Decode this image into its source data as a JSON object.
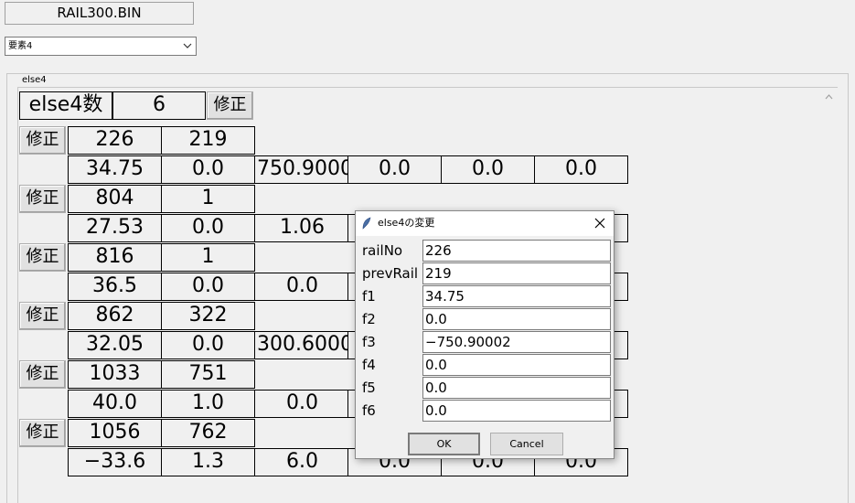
{
  "file_label": "RAIL300.BIN",
  "element_select": {
    "value": "要素4"
  },
  "group": {
    "label": "else4",
    "count_label": "else4数",
    "count_value": "6",
    "modify_label": "修正"
  },
  "records": [
    {
      "modify": "修正",
      "railNo": "226",
      "prevRail": "219",
      "vals": [
        "34.75",
        "0.0",
        "750.9000",
        "0.0",
        "0.0",
        "0.0"
      ]
    },
    {
      "modify": "修正",
      "railNo": "804",
      "prevRail": "1",
      "vals": [
        "27.53",
        "0.0",
        "1.06",
        "",
        "",
        ""
      ]
    },
    {
      "modify": "修正",
      "railNo": "816",
      "prevRail": "1",
      "vals": [
        "36.5",
        "0.0",
        "0.0",
        "",
        "",
        ""
      ]
    },
    {
      "modify": "修正",
      "railNo": "862",
      "prevRail": "322",
      "vals": [
        "32.05",
        "0.0",
        "300.6000",
        "",
        "",
        ""
      ]
    },
    {
      "modify": "修正",
      "railNo": "1033",
      "prevRail": "751",
      "vals": [
        "40.0",
        "1.0",
        "0.0",
        "",
        "",
        ""
      ]
    },
    {
      "modify": "修正",
      "railNo": "1056",
      "prevRail": "762",
      "vals": [
        "−33.6",
        "1.3",
        "6.0",
        "0.0",
        "0.0",
        "0.0"
      ]
    }
  ],
  "dialog": {
    "title": "else4の変更",
    "fields": [
      {
        "label": "railNo",
        "value": "226"
      },
      {
        "label": "prevRail",
        "value": "219"
      },
      {
        "label": "f1",
        "value": "34.75"
      },
      {
        "label": "f2",
        "value": "0.0"
      },
      {
        "label": "f3",
        "value": "−750.90002"
      },
      {
        "label": "f4",
        "value": "0.0"
      },
      {
        "label": "f5",
        "value": "0.0"
      },
      {
        "label": "f6",
        "value": "0.0"
      }
    ],
    "ok_label": "OK",
    "cancel_label": "Cancel"
  }
}
